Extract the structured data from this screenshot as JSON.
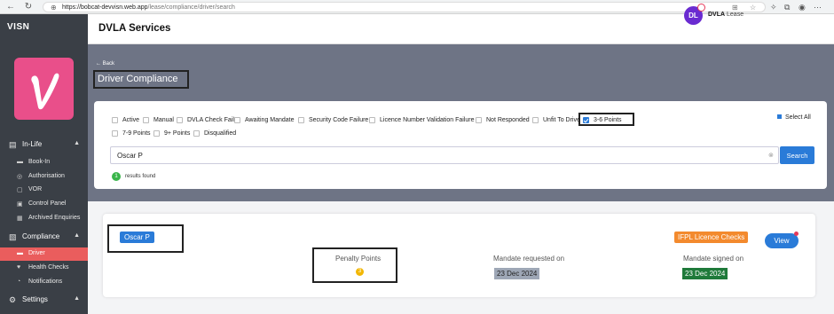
{
  "browser": {
    "url_host": "https://bobcat-devvisn.web.app",
    "url_path": "/lease/compliance/driver/search",
    "icons": [
      "back-arrow-icon",
      "refresh-icon",
      "lock-icon",
      "star-icon",
      "extensions-icon",
      "profile-icon",
      "more-icon"
    ]
  },
  "sidebar": {
    "brand": "VISN",
    "sections": [
      {
        "label": "In-Life",
        "icon": "clipboard-icon",
        "items": [
          {
            "label": "Book-In"
          },
          {
            "label": "Authorisation"
          },
          {
            "label": "VOR"
          },
          {
            "label": "Control Panel"
          },
          {
            "label": "Archived Enquiries"
          }
        ]
      },
      {
        "label": "Compliance",
        "icon": "compliance-icon",
        "items": [
          {
            "label": "Driver",
            "active": true
          },
          {
            "label": "Health Checks"
          },
          {
            "label": "Notifications"
          }
        ]
      },
      {
        "label": "Settings",
        "icon": "gear-icon",
        "items": []
      }
    ]
  },
  "header": {
    "title": "DVLA Services",
    "avatar": "DL",
    "org_name": "DVLA",
    "org_sub": "Lease"
  },
  "page": {
    "back": "← Back",
    "title": "Driver Compliance"
  },
  "filters": {
    "options": [
      {
        "label": "Active",
        "checked": false
      },
      {
        "label": "Manual",
        "checked": false
      },
      {
        "label": "DVLA Check Fail",
        "checked": false
      },
      {
        "label": "Awaiting Mandate",
        "checked": false
      },
      {
        "label": "Security Code Failure",
        "checked": false
      },
      {
        "label": "Licence Number Validation Failure",
        "checked": false
      },
      {
        "label": "Not Responded",
        "checked": false
      },
      {
        "label": "Unfit To Drive",
        "checked": false
      },
      {
        "label": "3-6 Points",
        "checked": true
      },
      {
        "label": "7-9 Points",
        "checked": false
      },
      {
        "label": "9+ Points",
        "checked": false
      },
      {
        "label": "Disqualified",
        "checked": false
      }
    ],
    "select_all": "Select All"
  },
  "search": {
    "value": "Oscar P",
    "button": "Search",
    "results_count": "1",
    "results_text": "results found"
  },
  "result": {
    "name": "Oscar P",
    "penalty_label": "Penalty Points",
    "penalty_value": "3",
    "mandate_requested_label": "Mandate requested on",
    "mandate_requested_date": "23 Dec 2024",
    "badge": "IFPL Licence Checks",
    "mandate_signed_label": "Mandate signed on",
    "mandate_signed_date": "23 Dec 2024",
    "view_button": "View"
  },
  "colors": {
    "accent": "#2a7bd8",
    "sidebar_bg": "#3a3f46",
    "active_item": "#ea5d5d",
    "logo": "#e94f8a",
    "badge_orange": "#f38a2e",
    "signed_green": "#1f7a3a"
  }
}
